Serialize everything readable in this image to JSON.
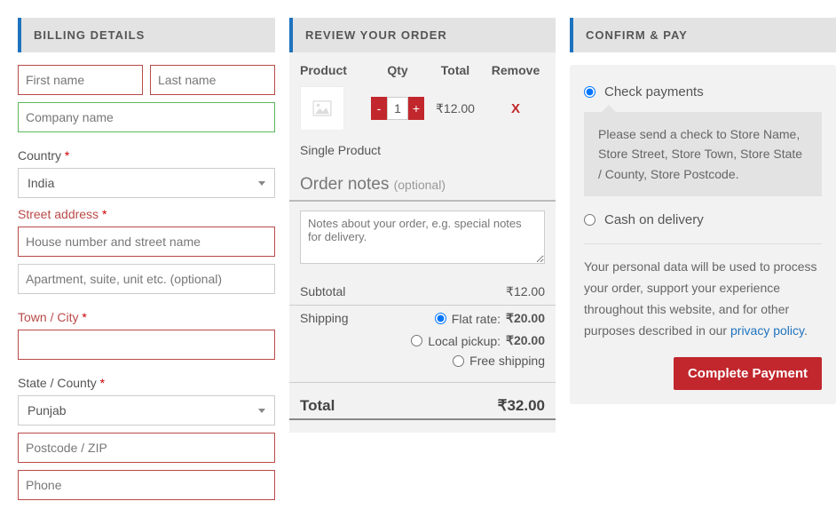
{
  "billing": {
    "title": "BILLING DETAILS",
    "first_name_ph": "First name",
    "last_name_ph": "Last name",
    "company_ph": "Company name",
    "country_label": "Country",
    "country_value": "India",
    "street_label": "Street address",
    "street1_ph": "House number and street name",
    "street2_ph": "Apartment, suite, unit etc. (optional)",
    "town_label": "Town / City",
    "state_label": "State / County",
    "state_value": "Punjab",
    "postcode_ph": "Postcode / ZIP",
    "phone_ph": "Phone",
    "required": "*"
  },
  "review": {
    "title": "REVIEW YOUR ORDER",
    "headers": {
      "product": "Product",
      "qty": "Qty",
      "total": "Total",
      "remove": "Remove"
    },
    "item": {
      "qty": "1",
      "total": "₹12.00",
      "remove": "X",
      "name": "Single Product",
      "minus": "-",
      "plus": "+"
    },
    "notes_title": "Order notes",
    "notes_optional": "(optional)",
    "notes_ph": "Notes about your order, e.g. special notes for delivery.",
    "subtotal_label": "Subtotal",
    "subtotal_value": "₹12.00",
    "shipping_label": "Shipping",
    "shipping_options": {
      "flat": {
        "label": "Flat rate:",
        "price": "₹20.00"
      },
      "local": {
        "label": "Local pickup:",
        "price": "₹20.00"
      },
      "free": {
        "label": "Free shipping"
      }
    },
    "total_label": "Total",
    "total_value": "₹32.00"
  },
  "confirm": {
    "title": "CONFIRM & PAY",
    "check_label": "Check payments",
    "check_desc": "Please send a check to Store Name, Store Street, Store Town, Store State / County, Store Postcode.",
    "cod_label": "Cash on delivery",
    "privacy_text_pre": "Your personal data will be used to process your order, support your experience throughout this website, and for other purposes described in our ",
    "privacy_link": "privacy policy",
    "privacy_text_post": ".",
    "complete_label": "Complete Payment"
  }
}
